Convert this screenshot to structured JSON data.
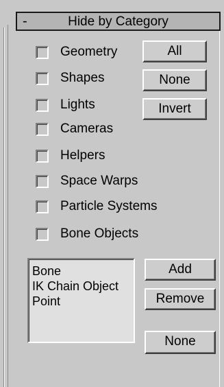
{
  "rollout": {
    "toggle": "-",
    "title": "Hide by Category"
  },
  "categories": [
    {
      "label": "Geometry",
      "checked": false
    },
    {
      "label": "Shapes",
      "checked": false
    },
    {
      "label": "Lights",
      "checked": false
    },
    {
      "label": "Cameras",
      "checked": false
    },
    {
      "label": "Helpers",
      "checked": false
    },
    {
      "label": "Space Warps",
      "checked": false
    },
    {
      "label": "Particle Systems",
      "checked": false
    },
    {
      "label": "Bone Objects",
      "checked": false
    }
  ],
  "buttons": {
    "all": "All",
    "none": "None",
    "invert": "Invert"
  },
  "object_list": {
    "items": [
      "Bone",
      "IK Chain Object",
      "Point"
    ]
  },
  "list_buttons": {
    "add": "Add",
    "remove": "Remove",
    "none": "None"
  }
}
